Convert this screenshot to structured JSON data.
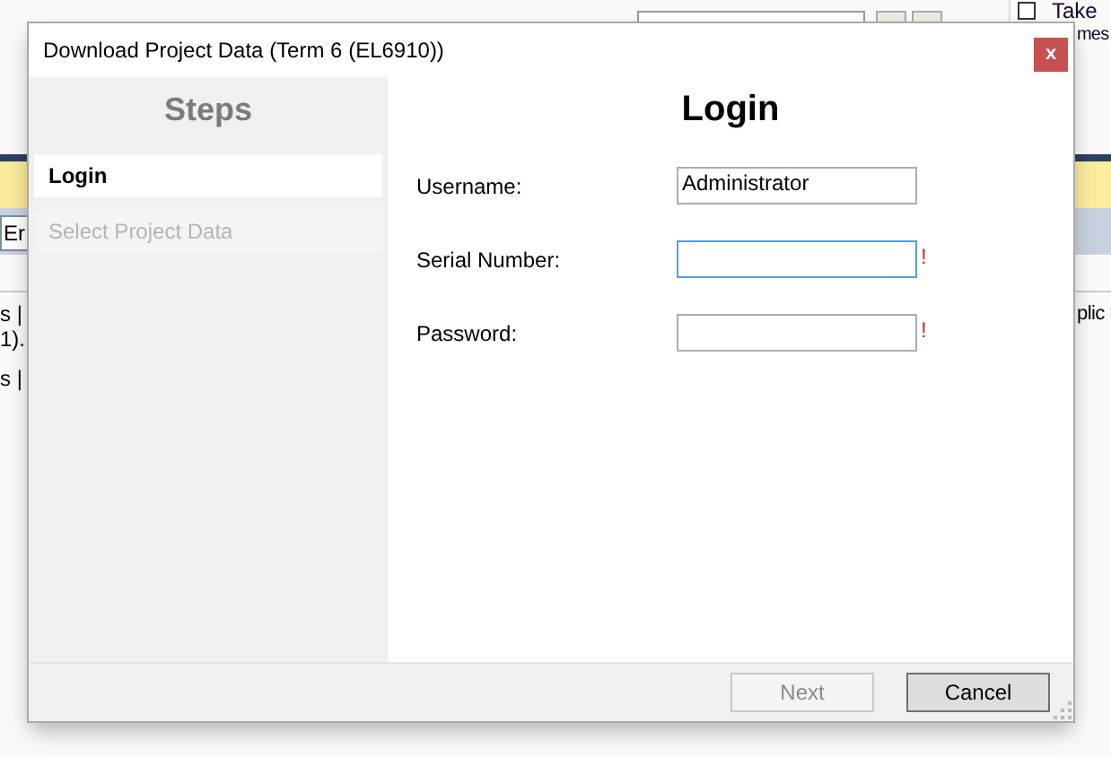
{
  "background_window": {
    "checkbox": {
      "checked": false,
      "label_lines": [
        "Take",
        "mes"
      ]
    },
    "tab_label": "Er",
    "left_lines": [
      "s |",
      "1).",
      "s |"
    ],
    "right_line": "plic"
  },
  "dialog": {
    "title": "Download Project Data (Term 6 (EL6910))",
    "close_button": "x",
    "sidebar": {
      "heading": "Steps",
      "steps": [
        {
          "label": "Login",
          "selected": true,
          "disabled": false
        },
        {
          "label": "Select Project Data",
          "selected": false,
          "disabled": true
        }
      ]
    },
    "heading": "Login",
    "fields": [
      {
        "label": "Username:",
        "value": "Administrator",
        "focused": false
      },
      {
        "label": "Serial Number:",
        "focused": true,
        "error_mark": "!"
      },
      {
        "label": "Password:",
        "focused": false,
        "error_mark": "!"
      }
    ],
    "buttons": [
      {
        "label": "Next",
        "disabled": true
      },
      {
        "label": "Cancel",
        "disabled": false
      }
    ]
  }
}
